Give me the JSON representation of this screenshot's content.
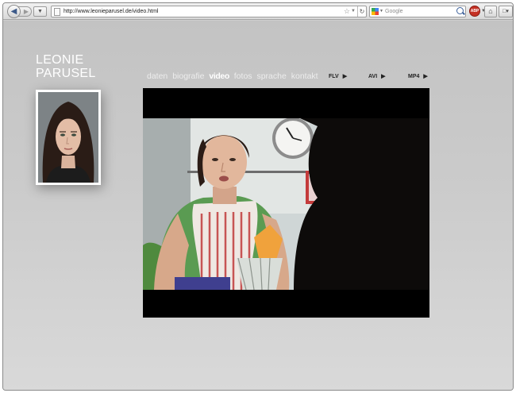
{
  "browser": {
    "url": "http://www.leonieparusel.de/video.html",
    "search_placeholder": "Google",
    "abp_label": "ABP"
  },
  "site": {
    "brand_line1": "LEONIE",
    "brand_line2": "PARUSEL",
    "nav": [
      {
        "label": "daten",
        "active": false
      },
      {
        "label": "biografie",
        "active": false
      },
      {
        "label": "video",
        "active": true
      },
      {
        "label": "fotos",
        "active": false
      },
      {
        "label": "sprache",
        "active": false
      },
      {
        "label": "kontakt",
        "active": false
      }
    ],
    "formats": [
      {
        "label": "FLV"
      },
      {
        "label": "AVI"
      },
      {
        "label": "MP4"
      }
    ]
  },
  "colors": {
    "page_bg": "#c8c8c8",
    "brand": "#ffffff",
    "nav_text": "#ededed",
    "video_bg": "#000000"
  },
  "icons": {
    "back": "back-arrow-icon",
    "forward": "forward-arrow-icon",
    "reload": "reload-icon",
    "home": "home-icon",
    "search": "magnifier-icon",
    "format_arrow": "play-triangle-icon"
  }
}
